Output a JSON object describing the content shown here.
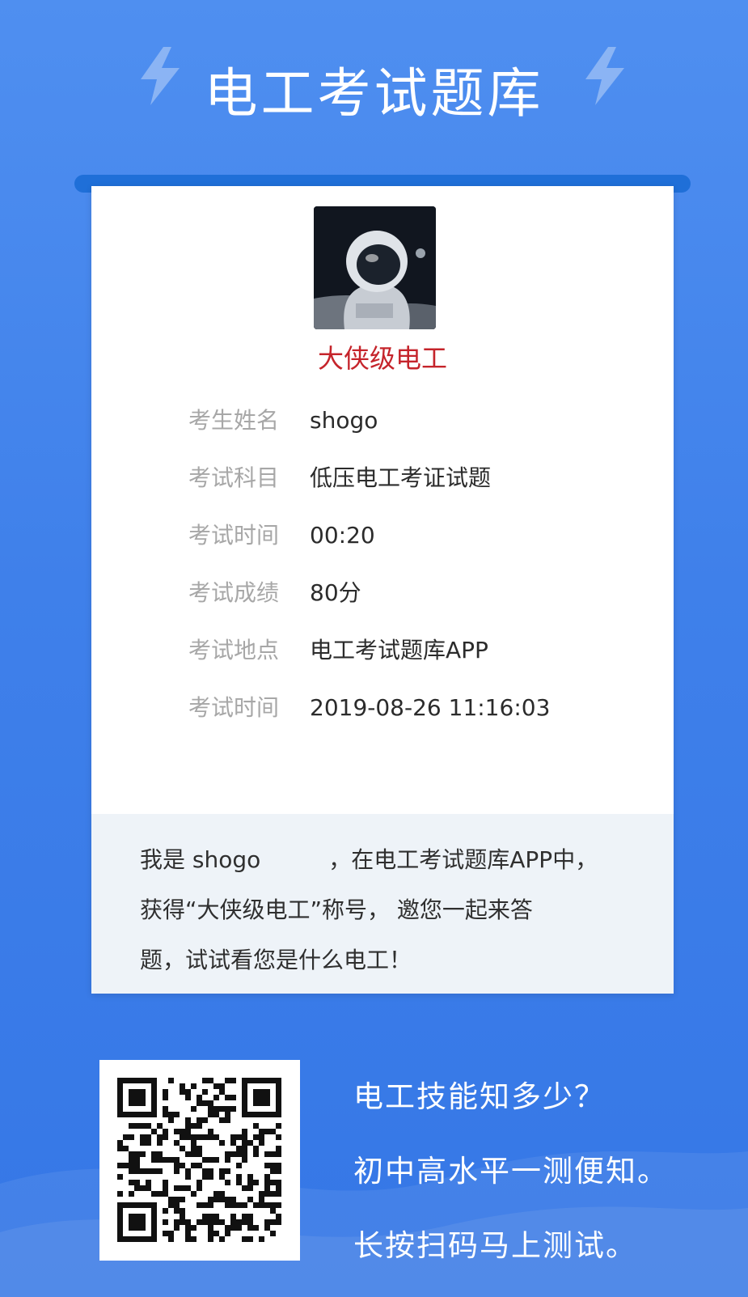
{
  "header": {
    "title": "电工考试题库"
  },
  "profile": {
    "badge": "大侠级电工",
    "avatar_icon": "astronaut-avatar"
  },
  "exam_info": [
    {
      "label": "考生姓名",
      "value": "shogo"
    },
    {
      "label": "考试科目",
      "value": "低压电工考证试题"
    },
    {
      "label": "考试时间",
      "value": "00:20"
    },
    {
      "label": "考试成绩",
      "value": "80分"
    },
    {
      "label": "考试地点",
      "value": "电工考试题库APP"
    },
    {
      "label": "考试时间",
      "value": "2019-08-26 11:16:03"
    }
  ],
  "share": {
    "line1": "我是 shogo　　　，在电工考试题库APP中，",
    "line2": "获得“大侠级电工”称号， 邀您一起来答",
    "line3": "题，试试看您是什么电工！"
  },
  "footer": {
    "slogan1": "电工技能知多少？",
    "slogan2": "初中高水平一测便知。",
    "slogan3": "长按扫码马上测试。"
  },
  "colors": {
    "background": "#3f80ea",
    "card_bar": "#1f6fd8",
    "badge": "#c5242b",
    "share_bg": "#eef3f8"
  },
  "icons": [
    "lightning-bolt-icon",
    "qr-code"
  ]
}
